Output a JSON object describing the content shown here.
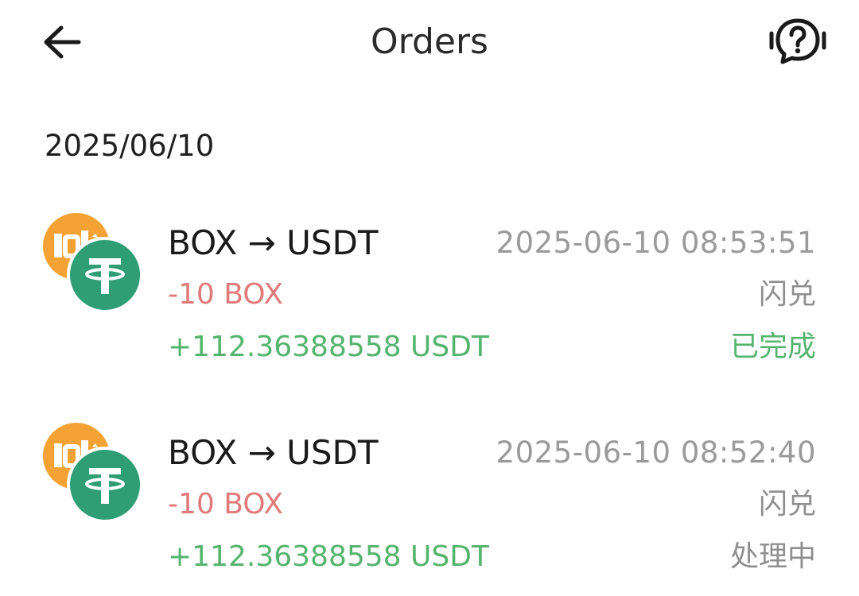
{
  "header": {
    "title": "Orders",
    "back_icon": "arrow-left-icon",
    "help_icon": "help-chat-icon"
  },
  "date_group": {
    "date": "2025/06/10"
  },
  "orders": [
    {
      "pair": "BOX → USDT",
      "time": "2025-06-10 08:53:51",
      "debit": "-10 BOX",
      "type": "闪兑",
      "credit": "+112.36388558 USDT",
      "status": "已完成",
      "status_color": "#55b46e"
    },
    {
      "pair": "BOX → USDT",
      "time": "2025-06-10 08:52:40",
      "debit": "-10 BOX",
      "type": "闪兑",
      "credit": "+112.36388558 USDT",
      "status": "处理中",
      "status_color": "#8f8f8f"
    }
  ],
  "colors": {
    "debit": "#e07a7a",
    "credit": "#55b46e",
    "box_coin": "#f4a233",
    "usdt_coin": "#2f9e74"
  }
}
